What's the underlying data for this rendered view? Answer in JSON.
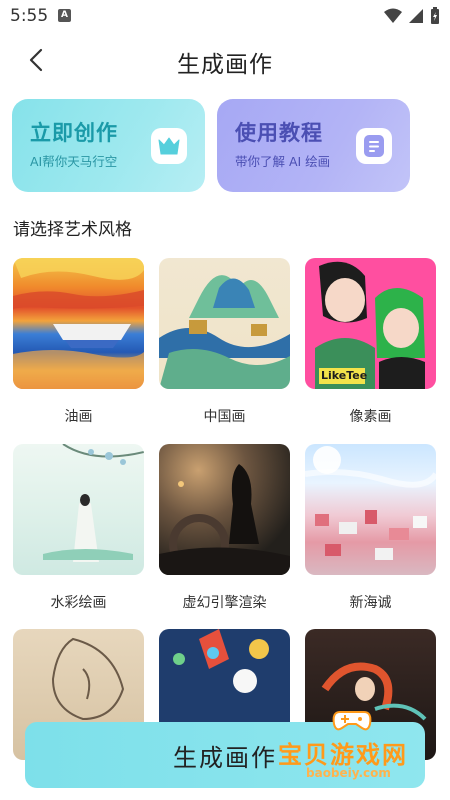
{
  "status_bar": {
    "time": "5:55",
    "notification_letter": "A"
  },
  "header": {
    "title": "生成画作",
    "back_icon": "chevron-left-icon"
  },
  "promo_cards": [
    {
      "title": "立即创作",
      "subtitle": "AI帮你天马行空",
      "icon": "crown-icon",
      "color": "#86e2ea"
    },
    {
      "title": "使用教程",
      "subtitle": "带你了解 AI 绘画",
      "icon": "document-icon",
      "color": "#a6a8f4"
    }
  ],
  "section_title": "请选择艺术风格",
  "styles": [
    {
      "label": "油画"
    },
    {
      "label": "中国画"
    },
    {
      "label": "像素画"
    },
    {
      "label": "水彩绘画"
    },
    {
      "label": "虚幻引擎渲染"
    },
    {
      "label": "新海诚"
    },
    {
      "label": ""
    },
    {
      "label": ""
    },
    {
      "label": ""
    }
  ],
  "pixel_art_caption": "LikeTee",
  "generate_button": "生成画作",
  "watermark": {
    "text": "宝贝游戏网",
    "url": "baobeiy.com"
  },
  "colors": {
    "accent_teal": "#7de0ea",
    "accent_purple": "#a6a8f4"
  }
}
